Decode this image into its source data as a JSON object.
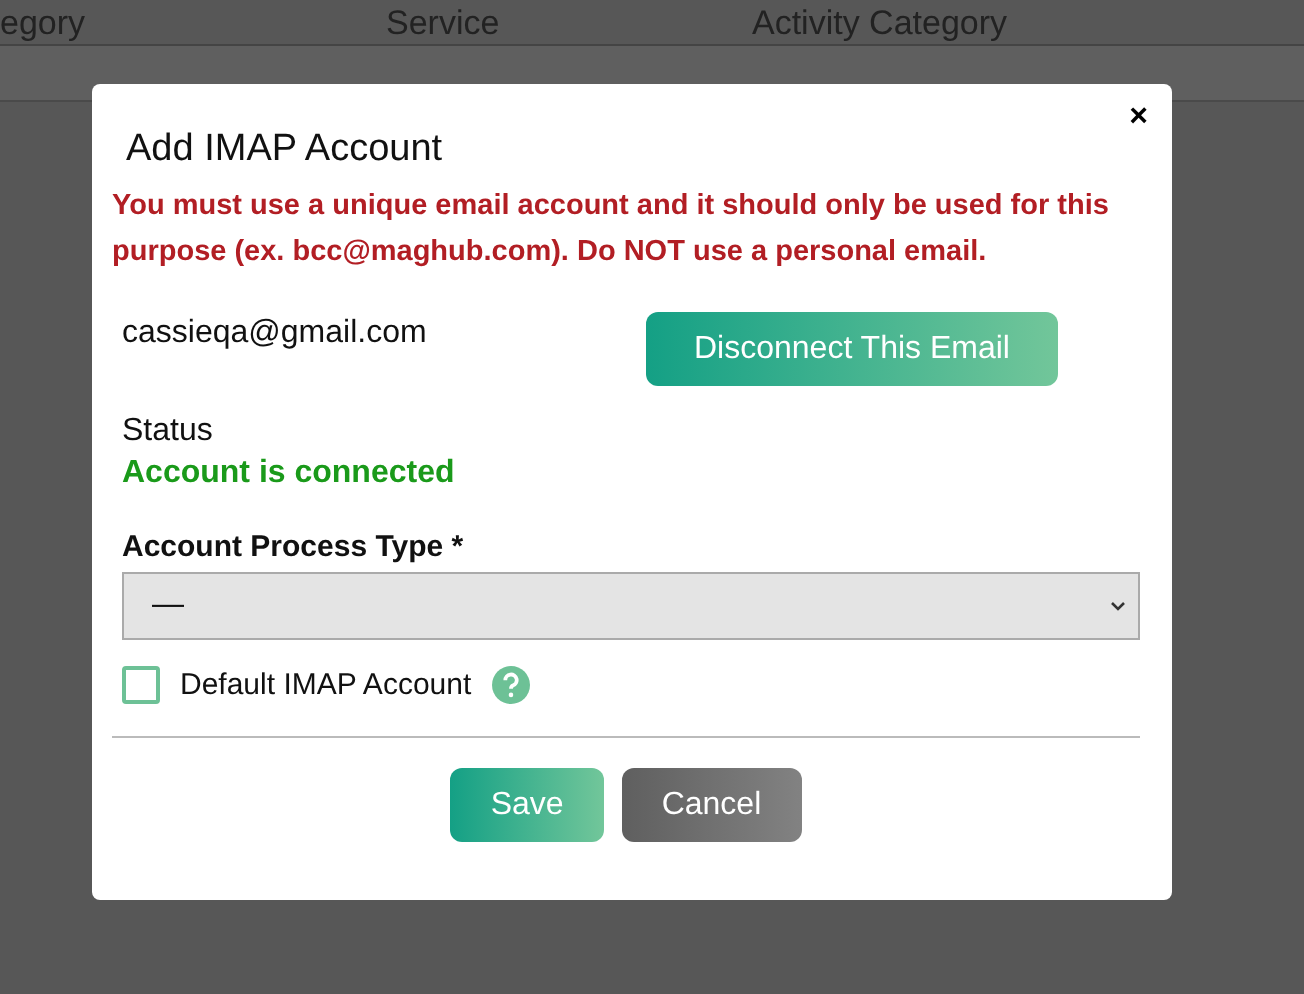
{
  "background": {
    "columns": [
      "egory",
      "Service",
      "Activity Category"
    ]
  },
  "dialog": {
    "title": "Add IMAP Account",
    "close": "×",
    "warning": "You must use a unique email account and it should only be used for this purpose (ex. bcc@maghub.com). Do NOT use a personal email.",
    "email": "cassieqa@gmail.com",
    "disconnect_button": "Disconnect This Email",
    "status_label": "Status",
    "status": "Account is connected",
    "connected": true,
    "process_type": {
      "label": "Account Process Type *",
      "value": "—"
    },
    "default_checkbox": {
      "label": "Default IMAP Account",
      "checked": false
    },
    "buttons": [
      {
        "label": "Save",
        "kind": "primary"
      },
      {
        "label": "Cancel",
        "kind": "secondary"
      }
    ]
  }
}
